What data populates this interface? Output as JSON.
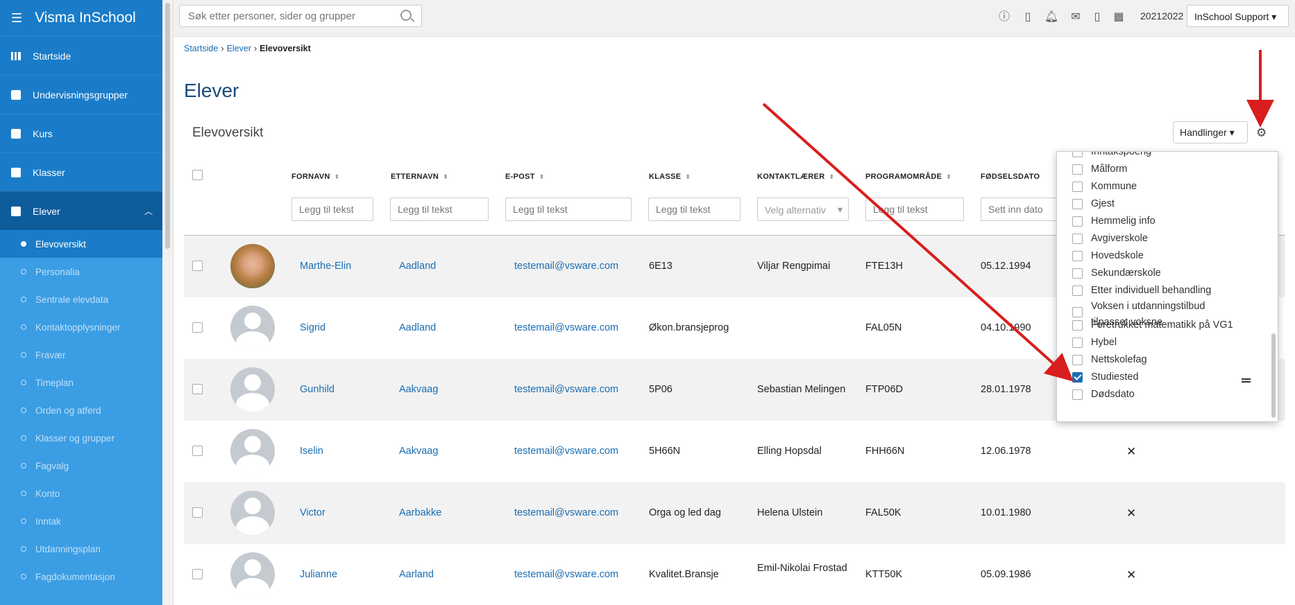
{
  "app": {
    "title": "Visma InSchool"
  },
  "sidebar": {
    "items": [
      {
        "label": "Startside"
      },
      {
        "label": "Undervisningsgrupper"
      },
      {
        "label": "Kurs"
      },
      {
        "label": "Klasser"
      },
      {
        "label": "Elever"
      }
    ],
    "subitems": [
      {
        "label": "Elevoversikt"
      },
      {
        "label": "Personalia"
      },
      {
        "label": "Sentrale elevdata"
      },
      {
        "label": "Kontaktopplysninger"
      },
      {
        "label": "Fravær"
      },
      {
        "label": "Timeplan"
      },
      {
        "label": "Orden og atferd"
      },
      {
        "label": "Klasser og grupper"
      },
      {
        "label": "Fagvalg"
      },
      {
        "label": "Konto"
      },
      {
        "label": "Inntak"
      },
      {
        "label": "Utdanningsplan"
      },
      {
        "label": "Fagdokumentasjon"
      }
    ]
  },
  "topbar": {
    "search_placeholder": "Søk etter personer, sider og grupper",
    "year": "20212022",
    "user_menu": "InSchool Support"
  },
  "breadcrumb": {
    "items": [
      "Startside",
      "Elever"
    ],
    "current": "Elevoversikt"
  },
  "page": {
    "title": "Elever",
    "section_title": "Elevoversikt",
    "actions_label": "Handlinger"
  },
  "table": {
    "headers": [
      "FORNAVN",
      "ETTERNAVN",
      "E-POST",
      "KLASSE",
      "KONTAKTLÆRER",
      "PROGRAMOMRÅDE",
      "FØDSELSDATO"
    ],
    "filter_placeholders": {
      "text": "Legg til tekst",
      "select": "Velg alternativ",
      "date": "Sett inn dato"
    },
    "rows": [
      {
        "fornavn": "Marthe-Elin",
        "etternavn": "Aadland",
        "epost": "testemail@vsware.com",
        "klasse": "6E13",
        "kontaktlaerer": "Viljar Rengpimai",
        "programomrade": "FTE13H",
        "fodselsdato": "05.12.1994",
        "x": ""
      },
      {
        "fornavn": "Sigrid",
        "etternavn": "Aadland",
        "epost": "testemail@vsware.com",
        "klasse": "Økon.bransjeprog",
        "kontaktlaerer": "",
        "programomrade": "FAL05N",
        "fodselsdato": "04.10.1990",
        "x": ""
      },
      {
        "fornavn": "Gunhild",
        "etternavn": "Aakvaag",
        "epost": "testemail@vsware.com",
        "klasse": "5P06",
        "kontaktlaerer": "Sebastian Melingen",
        "programomrade": "FTP06D",
        "fodselsdato": "28.01.1978",
        "x": ""
      },
      {
        "fornavn": "Iselin",
        "etternavn": "Aakvaag",
        "epost": "testemail@vsware.com",
        "klasse": "5H66N",
        "kontaktlaerer": "Elling Hopsdal",
        "programomrade": "FHH66N",
        "fodselsdato": "12.06.1978",
        "x": "✕"
      },
      {
        "fornavn": "Victor",
        "etternavn": "Aarbakke",
        "epost": "testemail@vsware.com",
        "klasse": "Orga og led dag",
        "kontaktlaerer": "Helena Ulstein",
        "programomrade": "FAL50K",
        "fodselsdato": "10.01.1980",
        "x": "✕"
      },
      {
        "fornavn": "Julianne",
        "etternavn": "Aarland",
        "epost": "testemail@vsware.com",
        "klasse": "Kvalitet.Bransje",
        "kontaktlaerer": "Emil-Nikolai Frostad",
        "programomrade": "KTT50K",
        "fodselsdato": "05.09.1986",
        "x": "✕"
      }
    ]
  },
  "column_popup": {
    "options": [
      {
        "label": "Inntakspoeng",
        "checked": false
      },
      {
        "label": "Målform",
        "checked": false
      },
      {
        "label": "Kommune",
        "checked": false
      },
      {
        "label": "Gjest",
        "checked": false
      },
      {
        "label": "Hemmelig info",
        "checked": false
      },
      {
        "label": "Avgiverskole",
        "checked": false
      },
      {
        "label": "Hovedskole",
        "checked": false
      },
      {
        "label": "Sekundærskole",
        "checked": false
      },
      {
        "label": "Etter individuell behandling",
        "checked": false
      },
      {
        "label": "Voksen i utdanningstilbud tilpasset voksne",
        "checked": false
      },
      {
        "label": "Foretrukket matematikk på VG1",
        "checked": false
      },
      {
        "label": "Hybel",
        "checked": false
      },
      {
        "label": "Nettskolefag",
        "checked": false
      },
      {
        "label": "Studiested",
        "checked": true
      },
      {
        "label": "Dødsdato",
        "checked": false
      }
    ]
  },
  "colors": {
    "sidebar": "#3b9de3",
    "sidebar_dark": "#1a7cc8",
    "link": "#1a6db3",
    "annotation_arrow": "#d81e1e"
  },
  "icons": [
    "hamburger-icon",
    "grid-icon",
    "book-icon",
    "class-icon",
    "student-icon",
    "search-icon",
    "help-icon",
    "contact-card-icon",
    "bell-icon",
    "mail-icon",
    "phone-icon",
    "calendar-icon",
    "gear-icon",
    "sort-icon",
    "avatar-icon"
  ]
}
